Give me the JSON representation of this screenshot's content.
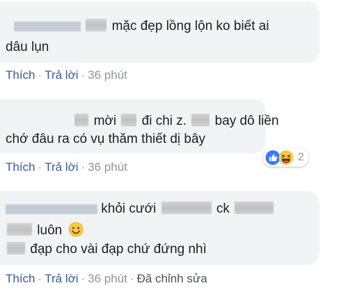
{
  "comments": [
    {
      "author": "",
      "lines": [
        {
          "text": "mặc đẹp lồng lộn ko biết ai"
        },
        {
          "text": "dâu lụn"
        }
      ],
      "actions": {
        "like": "Thích",
        "reply": "Trả lời",
        "time": "36 phút",
        "edited": ""
      }
    },
    {
      "author": "",
      "lines": [
        {
          "parts": [
            "mời",
            "đi chi z.",
            "bay dô liền"
          ]
        },
        {
          "text": "chớ đâu ra có vụ thăm thiết dị bây"
        }
      ],
      "reactions": {
        "types": [
          "like-icon",
          "haha-icon"
        ],
        "count": "2"
      },
      "actions": {
        "like": "Thích",
        "reply": "Trả lời",
        "time": "36 phút",
        "edited": ""
      }
    },
    {
      "author": "",
      "lines": [
        {
          "parts": [
            "khỏi cưới",
            "ck"
          ]
        },
        {
          "parts": [
            "luôn"
          ],
          "emoji": "smile-emoji-icon"
        },
        {
          "text": "đạp cho vài đạp chứ đứng nhì"
        }
      ],
      "actions": {
        "like": "Thích",
        "reply": "Trả lời",
        "time": "36 phút",
        "edited": "Đã chỉnh sửa"
      }
    }
  ],
  "colors": {
    "bubble": "#f2f3f5",
    "link": "#385898",
    "muted": "#90949c",
    "like_blue": "#3b7cf5",
    "haha_yellow": "#f7c945"
  }
}
